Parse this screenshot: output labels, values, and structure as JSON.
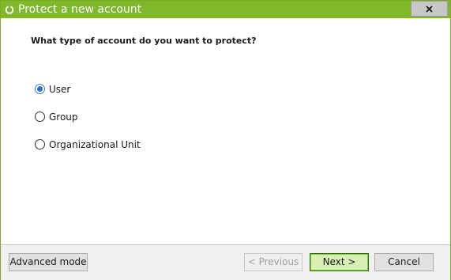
{
  "window": {
    "title": "Protect a new account",
    "accent_color": "#7fb829"
  },
  "question": "What type of account do you want to protect?",
  "options": [
    {
      "label": "User",
      "selected": true
    },
    {
      "label": "Group",
      "selected": false
    },
    {
      "label": "Organizational Unit",
      "selected": false
    }
  ],
  "footer": {
    "advanced_label": "Advanced mode",
    "previous_label": "< Previous",
    "previous_enabled": false,
    "next_label": "Next >",
    "cancel_label": "Cancel"
  }
}
